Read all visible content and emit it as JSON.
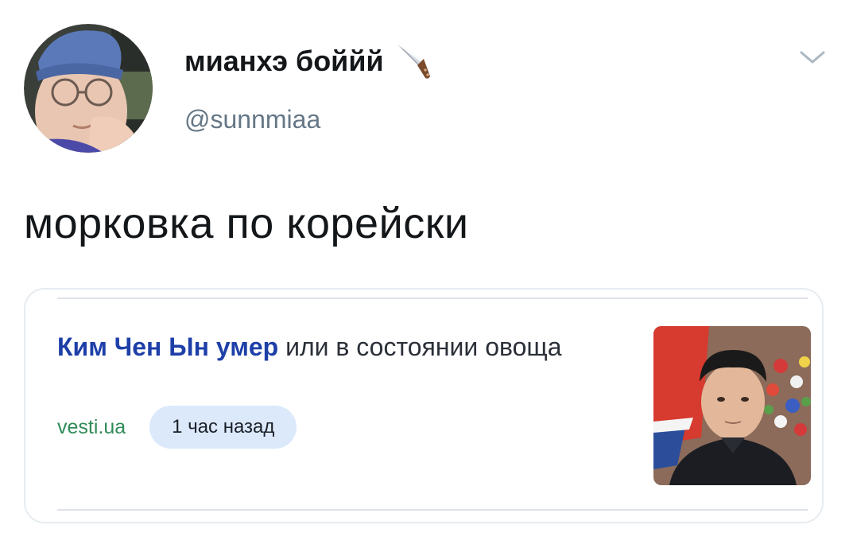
{
  "tweet": {
    "display_name": "мианхэ боййй",
    "username": "@sunnmiaa",
    "text": "морковка по корейски",
    "name_emoji_icon": "kitchen-knife-icon",
    "menu_icon": "chevron-down-icon"
  },
  "card": {
    "headline_link": "Ким Чен Ын умер",
    "headline_rest": " или в состоянии овоща",
    "source": "vesti.ua",
    "time_ago": "1 час назад",
    "thumbnail_icon": "news-photo"
  },
  "colors": {
    "headline_link": "#1e3fa8",
    "source_link": "#2e8b57",
    "time_badge_bg": "#dbe9fb",
    "username": "#657786"
  }
}
